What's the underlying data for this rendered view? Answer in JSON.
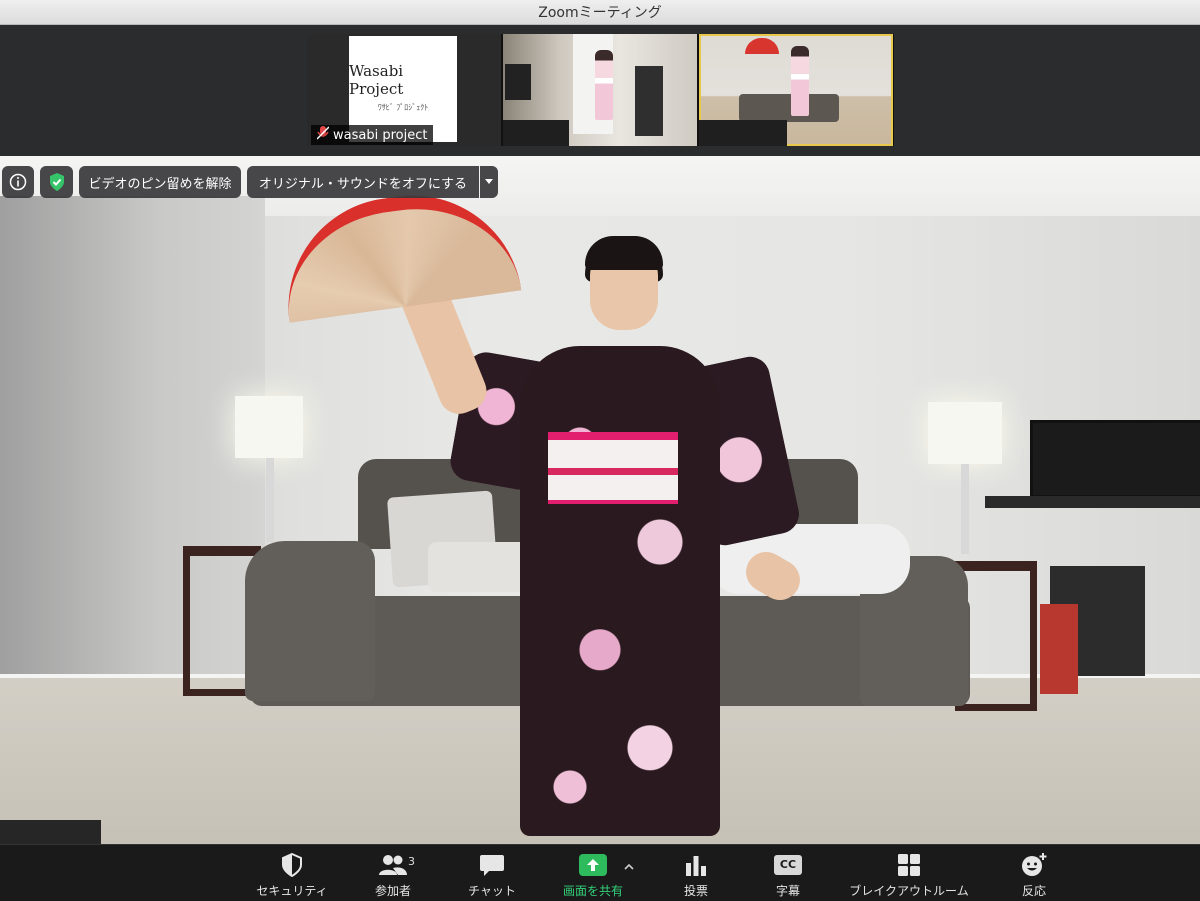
{
  "window": {
    "title": "Zoomミーティング"
  },
  "thumbnails": [
    {
      "name": "wasabi project",
      "logo_text": "Wasabi Project",
      "logo_subtext": "ﾜｻﾋﾞ ﾌﾟﾛｼﾞｪｸﾄ",
      "muted": true
    },
    {
      "name": ""
    },
    {
      "name": "",
      "active": true
    }
  ],
  "video_controls": {
    "unpin_label": "ビデオのピン留めを解除",
    "original_sound_label": "オリジナル・サウンドをオフにする"
  },
  "toolbar": {
    "security": "セキュリティ",
    "participants": "参加者",
    "participants_count": "3",
    "chat": "チャット",
    "share_screen": "画面を共有",
    "polls": "投票",
    "captions": "字幕",
    "captions_icon_text": "CC",
    "breakout": "ブレイクアウトルーム",
    "reactions": "反応"
  },
  "colors": {
    "share_green": "#2dbb5d",
    "active_border": "#e8c84a",
    "shield_green": "#36c46a"
  }
}
